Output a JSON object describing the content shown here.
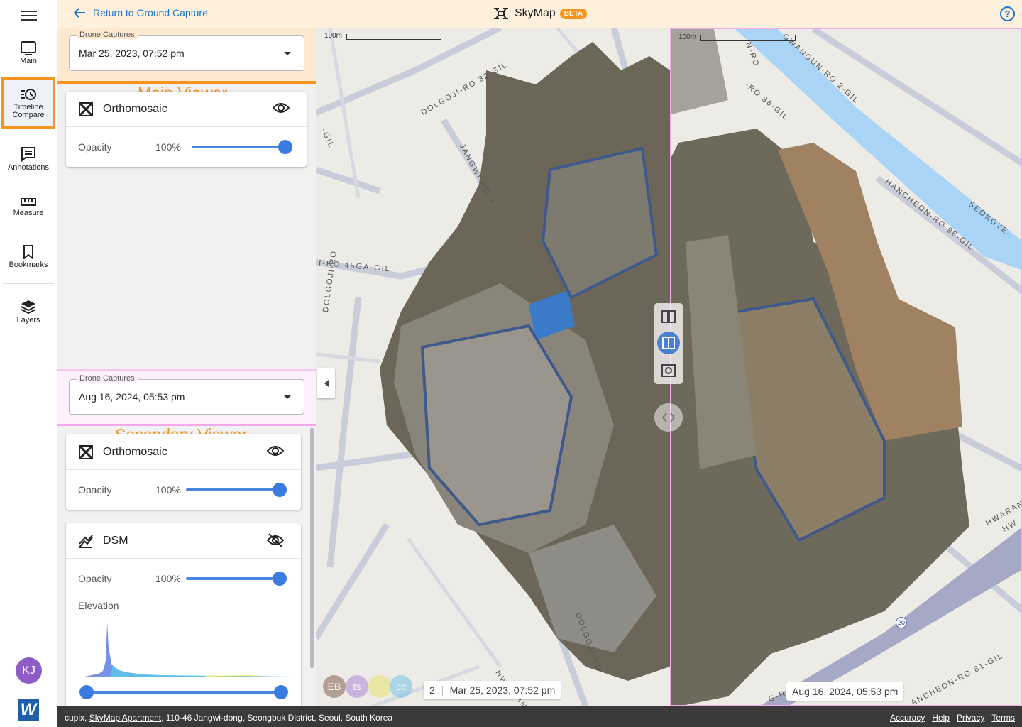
{
  "rail": {
    "items": [
      {
        "label": "Main",
        "icon": "monitor-icon"
      },
      {
        "label": "Timeline Compare",
        "label1": "Timeline",
        "label2": "Compare",
        "icon": "timeline-icon"
      },
      {
        "label": "Annotations",
        "icon": "annotations-icon"
      },
      {
        "label": "Measure",
        "icon": "ruler-icon"
      },
      {
        "label": "Bookmarks",
        "icon": "bookmark-icon"
      },
      {
        "label": "Layers",
        "icon": "layers-icon"
      }
    ],
    "avatar": "KJ",
    "logo": "W"
  },
  "topbar": {
    "back_label": "Return to Ground Capture",
    "brand": "SkyMap",
    "badge": "BETA",
    "help": "?"
  },
  "main_viewer": {
    "title": "Main Viewer",
    "capture_label": "Drone Captures",
    "capture_value": "Mar 25, 2023, 07:52 pm",
    "layers": [
      {
        "name": "Orthomosaic",
        "opacity_label": "Opacity",
        "opacity": "100%",
        "visible": true
      }
    ]
  },
  "secondary_viewer": {
    "title": "Secondary Viewer",
    "capture_label": "Drone Captures",
    "capture_value": "Aug 16, 2024, 05:53 pm",
    "layers": [
      {
        "name": "Orthomosaic",
        "opacity_label": "Opacity",
        "opacity": "100%",
        "visible": true
      },
      {
        "name": "DSM",
        "opacity_label": "Opacity",
        "opacity": "100%",
        "visible": false,
        "elevation_label": "Elevation"
      }
    ]
  },
  "map_left": {
    "scale": "100m",
    "chip_num": "2",
    "chip_date": "Mar 25, 2023, 07:52 pm",
    "streets": [
      "DOLGOJI-RO 32-GIL",
      "JANGWI-RO 4",
      "-GIL",
      "I-RO 45GA-GIL",
      "DOLGOJI-RO",
      "DOLGOJI-RO",
      "HW",
      "AN"
    ],
    "avatars": [
      "EB",
      "ts",
      "",
      "cc"
    ]
  },
  "map_right": {
    "scale": "100m",
    "chip_date": "Aug 16, 2024, 05:53 pm",
    "streets": [
      "GWANGUN-RO 2-GIL",
      "N-RO",
      "-RO 96-GIL",
      "HANCHEON-RO 96-GIL",
      "SEOKGYE-",
      "HWARAN",
      "HW",
      "ANCHEON-RO 81-GIL",
      "G-RO"
    ],
    "road_shield": "20"
  },
  "footer": {
    "org": "cupix,",
    "project": "SkyMap Apartment",
    "address": ", 110-46 Jangwi-dong, Seongbuk District, Seoul, South Korea",
    "links": [
      "Accuracy",
      "Help",
      "Privacy",
      "Terms"
    ]
  },
  "colors": {
    "accent": "#f7941d",
    "primary": "#1976d2",
    "secondary": "#f3a9ec"
  }
}
